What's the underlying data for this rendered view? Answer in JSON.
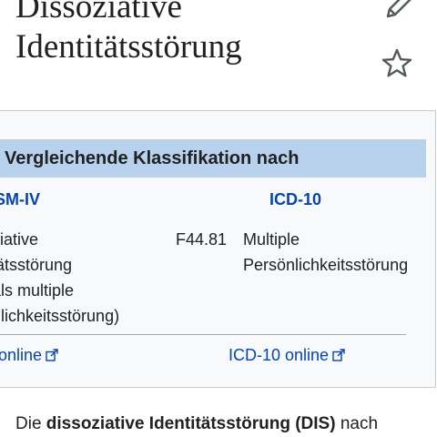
{
  "page": {
    "title_line1": "Dissoziative",
    "title_line2": "Identitätsstörung"
  },
  "icons": {
    "edit": "pencil-icon",
    "watch": "star-icon",
    "external": "external-link-icon"
  },
  "infobox": {
    "header": "Vergleichende Klassifikation nach",
    "dsm": {
      "heading": "DSM-IV",
      "name_lines": [
        "oziative",
        "titätsstörung",
        "nals multiple",
        "önlichkeitsstörung)"
      ],
      "link": "V online"
    },
    "icd": {
      "heading": "ICD-10",
      "code": "F44.81",
      "name_lines": [
        "Multiple",
        "Persönlichkeitsstörung"
      ],
      "link": "ICD-10 online"
    }
  },
  "article": {
    "intro_prefix": "Die ",
    "intro_bold": "dissoziative Identitätsstörung (DIS)",
    "intro_suffix": " nach"
  },
  "colors": {
    "link": "#0645ad",
    "header_bg": "#b8d2ee",
    "infobox_bg": "#f8f9fa",
    "border": "#c8ccd1"
  }
}
